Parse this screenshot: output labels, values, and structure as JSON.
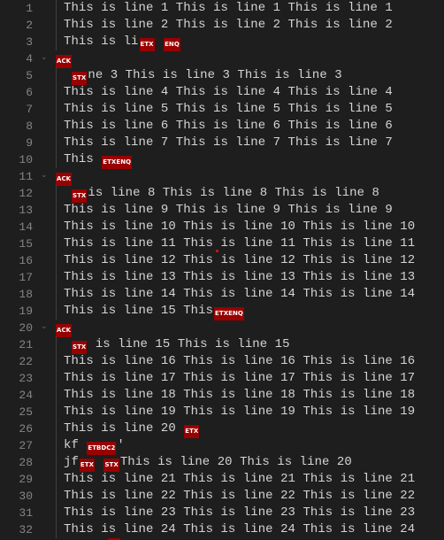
{
  "editor": {
    "lines": [
      {
        "n": "1",
        "segs": [
          {
            "t": "This is line 1 This is line 1 This is line 1"
          }
        ]
      },
      {
        "n": "2",
        "segs": [
          {
            "t": "This is line 2 This is line 2 This is line 2"
          }
        ]
      },
      {
        "n": "3",
        "segs": [
          {
            "t": "This is li"
          },
          {
            "c": "ETX"
          },
          {
            "t": " "
          },
          {
            "c": "ENQ"
          }
        ]
      },
      {
        "n": "4",
        "kind": "ack",
        "fold": true,
        "segs": [
          {
            "c": "ACK"
          }
        ]
      },
      {
        "n": "5",
        "kind": "indent",
        "segs": [
          {
            "c": "STX"
          },
          {
            "t": "ne 3 This is line 3 This is line 3"
          }
        ]
      },
      {
        "n": "6",
        "segs": [
          {
            "t": "This is line 4 This is line 4 This is line 4"
          }
        ]
      },
      {
        "n": "7",
        "segs": [
          {
            "t": "This is line 5 This is line 5 This is line 5"
          }
        ]
      },
      {
        "n": "8",
        "segs": [
          {
            "t": "This is line 6 This is line 6 This is line 6"
          }
        ]
      },
      {
        "n": "9",
        "segs": [
          {
            "t": "This is line 7 This is line 7 This is line 7"
          }
        ]
      },
      {
        "n": "10",
        "segs": [
          {
            "t": "This "
          },
          {
            "c": "ETXENQ"
          }
        ]
      },
      {
        "n": "11",
        "kind": "ack",
        "fold": true,
        "segs": [
          {
            "c": "ACK"
          }
        ]
      },
      {
        "n": "12",
        "kind": "indent",
        "segs": [
          {
            "c": "STX"
          },
          {
            "t": "is line 8 This is line 8 This is line 8"
          }
        ]
      },
      {
        "n": "13",
        "segs": [
          {
            "t": "This is line 9 This is line 9 This is line 9"
          }
        ]
      },
      {
        "n": "14",
        "segs": [
          {
            "t": "This is line 10 This is line 10 This is line 10"
          }
        ]
      },
      {
        "n": "15",
        "segs": [
          {
            "t": "This is line 11 This is line 11 This is line 11"
          }
        ]
      },
      {
        "n": "16",
        "segs": [
          {
            "t": "This is line 12 This is line 12 This is line 12"
          }
        ]
      },
      {
        "n": "17",
        "segs": [
          {
            "t": "This is line 13 This is line 13 This is line 13"
          }
        ]
      },
      {
        "n": "18",
        "segs": [
          {
            "t": "This is line 14 This is line 14 This is line 14"
          }
        ]
      },
      {
        "n": "19",
        "segs": [
          {
            "t": "This is line 15 This"
          },
          {
            "c": "ETXENQ"
          }
        ]
      },
      {
        "n": "20",
        "kind": "ack",
        "fold": true,
        "segs": [
          {
            "c": "ACK"
          }
        ]
      },
      {
        "n": "21",
        "kind": "indent",
        "segs": [
          {
            "c": "STX"
          },
          {
            "t": " is line 15 This is line 15"
          }
        ]
      },
      {
        "n": "22",
        "segs": [
          {
            "t": "This is line 16 This is line 16 This is line 16"
          }
        ]
      },
      {
        "n": "23",
        "segs": [
          {
            "t": "This is line 17 This is line 17 This is line 17"
          }
        ]
      },
      {
        "n": "24",
        "segs": [
          {
            "t": "This is line 18 This is line 18 This is line 18"
          }
        ]
      },
      {
        "n": "25",
        "segs": [
          {
            "t": "This is line 19 This is line 19 This is line 19"
          }
        ]
      },
      {
        "n": "26",
        "segs": [
          {
            "t": "This is line 20 "
          },
          {
            "c": "ETX"
          }
        ]
      },
      {
        "n": "27",
        "segs": [
          {
            "t": "kf "
          },
          {
            "c": "ETBDC2"
          },
          {
            "t": "'"
          }
        ]
      },
      {
        "n": "28",
        "segs": [
          {
            "t": "jf"
          },
          {
            "c": "ETX"
          },
          {
            "t": " "
          },
          {
            "c": "STX"
          },
          {
            "t": "This is line 20 This is line 20"
          }
        ]
      },
      {
        "n": "29",
        "segs": [
          {
            "t": "This is line 21 This is line 21 This is line 21"
          }
        ]
      },
      {
        "n": "30",
        "segs": [
          {
            "t": "This is line 22 This is line 22 This is line 22"
          }
        ]
      },
      {
        "n": "31",
        "segs": [
          {
            "t": "This is line 23 This is line 23 This is line 23"
          }
        ]
      },
      {
        "n": "32",
        "segs": [
          {
            "t": "This is line 24 This is line 24 This is line 24"
          }
        ]
      }
    ],
    "fold_icon": "chevron-down-icon",
    "colors": {
      "background": "#1e1e1e",
      "text": "#d4d4d4",
      "line_number": "#858585",
      "control_char_bg": "#990000"
    }
  }
}
